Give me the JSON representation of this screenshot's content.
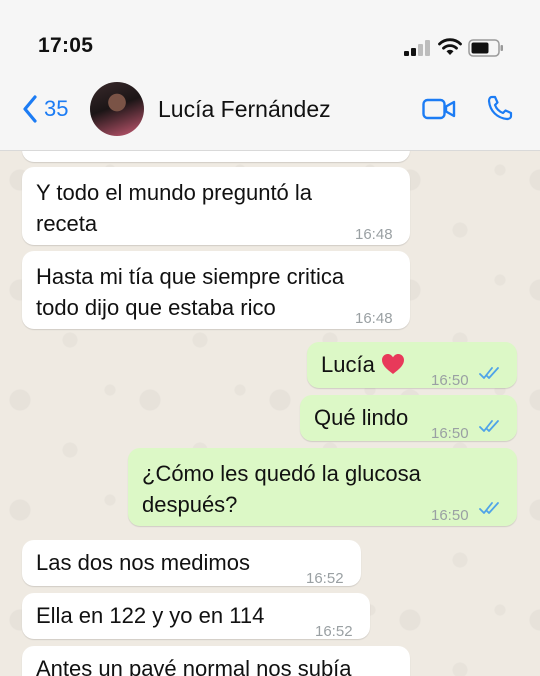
{
  "status": {
    "time": "17:05"
  },
  "header": {
    "back_count": "35",
    "contact_name": "Lucía Fernández"
  },
  "messages": [
    {
      "dir": "in",
      "lines": [
        "Y todo el mundo preguntó la",
        "receta"
      ],
      "time": "16:48"
    },
    {
      "dir": "in",
      "lines": [
        "Hasta mi tía que siempre critica",
        "todo dijo que estaba rico"
      ],
      "time": "16:48"
    },
    {
      "dir": "out",
      "lines": [
        "Lucía"
      ],
      "time": "16:50",
      "emoji": "heart"
    },
    {
      "dir": "out",
      "lines": [
        "Qué lindo"
      ],
      "time": "16:50"
    },
    {
      "dir": "out",
      "lines": [
        "¿Cómo les quedó la glucosa",
        "después?"
      ],
      "time": "16:50"
    },
    {
      "dir": "in",
      "lines": [
        "Las dos nos medimos"
      ],
      "time": "16:52"
    },
    {
      "dir": "in",
      "lines": [
        "Ella en 122 y yo en 114"
      ],
      "time": "16:52"
    },
    {
      "dir": "in",
      "lines": [
        "Antes un pavé normal nos subía"
      ],
      "time": ""
    }
  ],
  "colors": {
    "accent": "#1c7cf4",
    "outgoing_bubble": "#dcf8c6",
    "incoming_bubble": "#ffffff",
    "read_ticks": "#4fa3e8"
  }
}
